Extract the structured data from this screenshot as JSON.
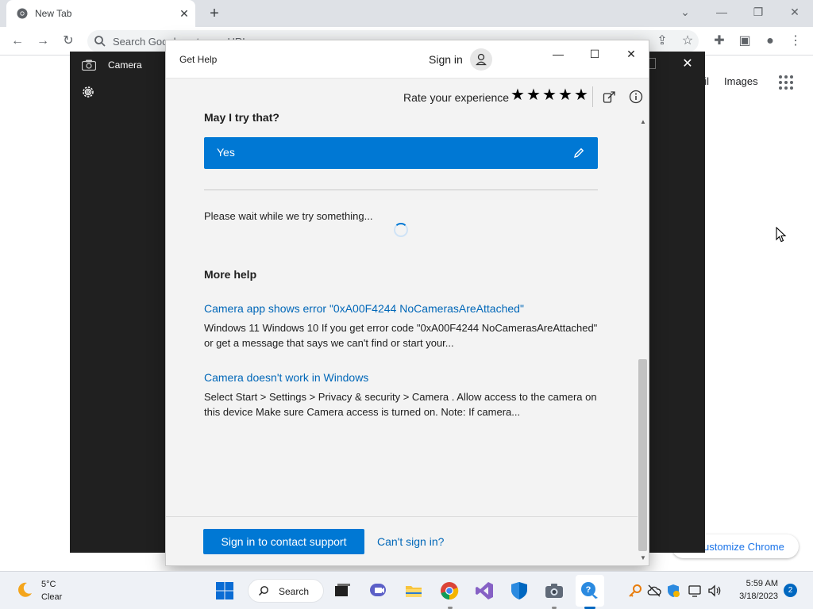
{
  "chrome": {
    "tab_title": "New Tab",
    "omnibox_placeholder": "Search Google or type a URL",
    "gmail_label": "ail",
    "images_label": "Images",
    "customize_label": "ustomize Chrome"
  },
  "camera": {
    "title": "Camera"
  },
  "get_help": {
    "title": "Get Help",
    "sign_in": "Sign in",
    "rate_label": "Rate your experience",
    "stars": [
      "★",
      "★",
      "★",
      "★",
      "★"
    ],
    "question": "May I try that?",
    "answer": "Yes",
    "wait_text": "Please wait while we try something...",
    "more_help_heading": "More help",
    "results": [
      {
        "title": "Camera app shows error \"0xA00F4244 NoCamerasAreAttached\"",
        "desc": "Windows 11 Windows 10 If you get error code \"0xA00F4244 NoCamerasAreAttached\" or get a message that says we can't find or start your..."
      },
      {
        "title": "Camera doesn't work in Windows",
        "desc": "Select Start > Settings > Privacy & security > Camera . Allow access to the camera on this device Make sure Camera access is turned on. Note: If camera..."
      }
    ],
    "contact_button": "Sign in to contact support",
    "cant_sign_in": "Can't sign in?"
  },
  "taskbar": {
    "weather_temp": "5°C",
    "weather_condition": "Clear",
    "search_label": "Search",
    "time": "5:59 AM",
    "date": "3/18/2023",
    "notification_count": "2"
  },
  "colors": {
    "accent": "#0078d4",
    "link": "#0067b8",
    "camera_bg": "#202020",
    "window_bg": "#f3f3f3"
  }
}
